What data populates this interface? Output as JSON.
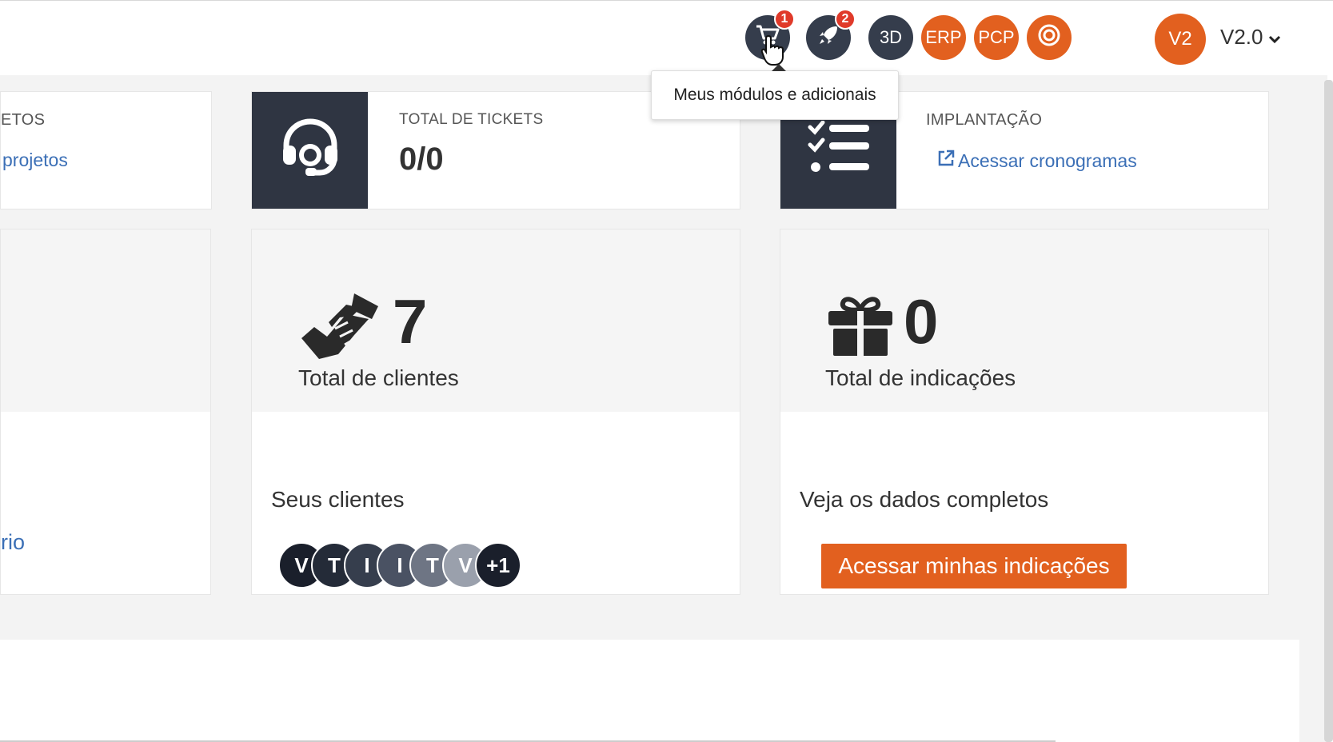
{
  "topbar": {
    "cart_badge": "1",
    "rocket_badge": "2",
    "btn_3d": "3D",
    "btn_erp": "ERP",
    "btn_pcp": "PCP",
    "avatar": "V2",
    "version": "V2.0"
  },
  "tooltip": "Meus módulos e adicionais",
  "cards": {
    "projects": {
      "label": "ETOS",
      "link": "projetos"
    },
    "tickets": {
      "label": "TOTAL DE TICKETS",
      "value": "0/0"
    },
    "implant": {
      "label": "IMPLANTAÇÃO",
      "link": "Acessar cronogramas"
    }
  },
  "left_panel": {
    "link": "rio"
  },
  "clients": {
    "value": "7",
    "label": "Total de clientes",
    "sub": "Seus clientes",
    "dots": [
      {
        "letter": "V",
        "color": "#1a1f2b"
      },
      {
        "letter": "T",
        "color": "#242b38"
      },
      {
        "letter": "I",
        "color": "#363e4d"
      },
      {
        "letter": "I",
        "color": "#4a5263"
      },
      {
        "letter": "T",
        "color": "#6e7584"
      },
      {
        "letter": "V",
        "color": "#9aa0ac"
      },
      {
        "letter": "+1",
        "color": "#1a1f2b"
      }
    ]
  },
  "referrals": {
    "value": "0",
    "label": "Total de indicações",
    "sub": "Veja os dados completos",
    "button": "Acessar minhas indicações"
  }
}
